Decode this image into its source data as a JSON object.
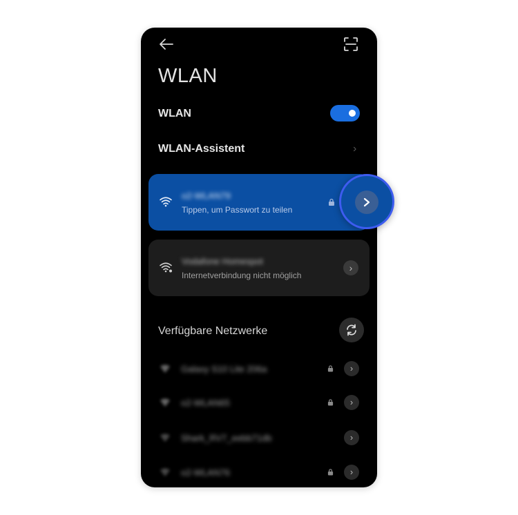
{
  "header": {
    "back_icon": "arrow-left-icon",
    "scan_icon": "qr-scan-icon",
    "title": "WLAN"
  },
  "settings": {
    "wlan_label": "WLAN",
    "wlan_enabled": true,
    "assistant_label": "WLAN-Assistent"
  },
  "connected_network": {
    "name": "o2-WLAN79",
    "subtitle": "Tippen, um Passwort zu teilen",
    "secured": true
  },
  "saved_network": {
    "name": "Vodafone Homespot",
    "subtitle": "Internetverbindung nicht möglich"
  },
  "available": {
    "section_title": "Verfügbare Netzwerke",
    "networks": [
      {
        "name": "Galaxy S10 Lite 206a",
        "secured": true
      },
      {
        "name": "o2-WLAN65",
        "secured": true
      },
      {
        "name": "Shark_RV7_eebb71db",
        "secured": false
      },
      {
        "name": "o2-WLAN76",
        "secured": true
      }
    ]
  },
  "colors": {
    "accent": "#0b4fa3",
    "toggle_on": "#1a6ee0",
    "highlight_ring": "#3e5cf0",
    "background": "#000000"
  }
}
